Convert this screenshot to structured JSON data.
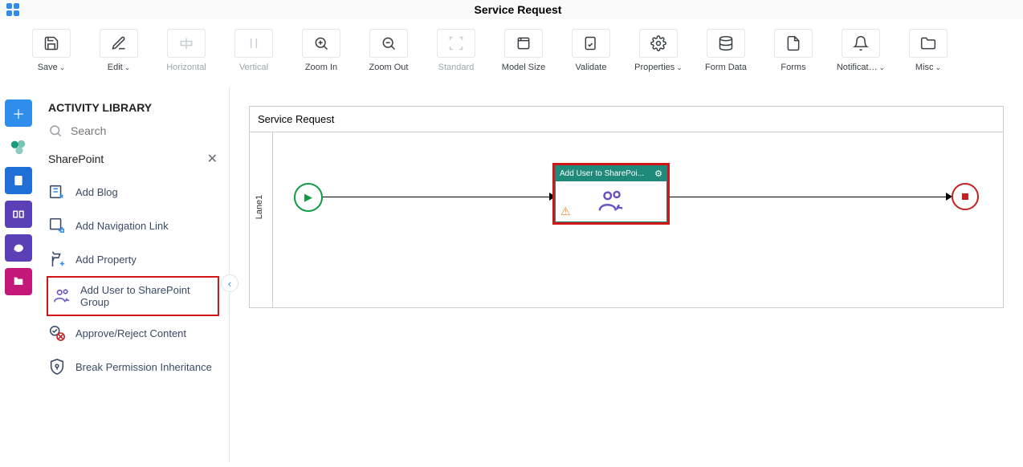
{
  "header": {
    "title": "Service Request"
  },
  "toolbar": [
    {
      "label": "Save",
      "icon": "save",
      "dropdown": true
    },
    {
      "label": "Edit",
      "icon": "edit",
      "dropdown": true
    },
    {
      "label": "Horizontal",
      "icon": "align-h",
      "disabled": true
    },
    {
      "label": "Vertical",
      "icon": "align-v",
      "disabled": true
    },
    {
      "label": "Zoom In",
      "icon": "zoom-in"
    },
    {
      "label": "Zoom Out",
      "icon": "zoom-out"
    },
    {
      "label": "Standard",
      "icon": "standard",
      "disabled": true
    },
    {
      "label": "Model Size",
      "icon": "model-size"
    },
    {
      "label": "Validate",
      "icon": "validate"
    },
    {
      "label": "Properties",
      "icon": "properties",
      "dropdown": true
    },
    {
      "label": "Form Data",
      "icon": "form-data"
    },
    {
      "label": "Forms",
      "icon": "forms"
    },
    {
      "label": "Notificat…",
      "icon": "notifications",
      "dropdown": true
    },
    {
      "label": "Misc",
      "icon": "misc",
      "dropdown": true
    }
  ],
  "sidebar": {
    "title": "ACTIVITY LIBRARY",
    "search_placeholder": "Search",
    "category": "SharePoint",
    "items": [
      "Add Blog",
      "Add Navigation Link",
      "Add Property",
      "Add User to SharePoint Group",
      "Approve/Reject Content",
      "Break Permission Inheritance"
    ],
    "highlighted_index": 3
  },
  "canvas": {
    "process_name": "Service Request",
    "lane": "Lane1",
    "activity_node": {
      "label": "Add User to SharePoi..."
    }
  }
}
